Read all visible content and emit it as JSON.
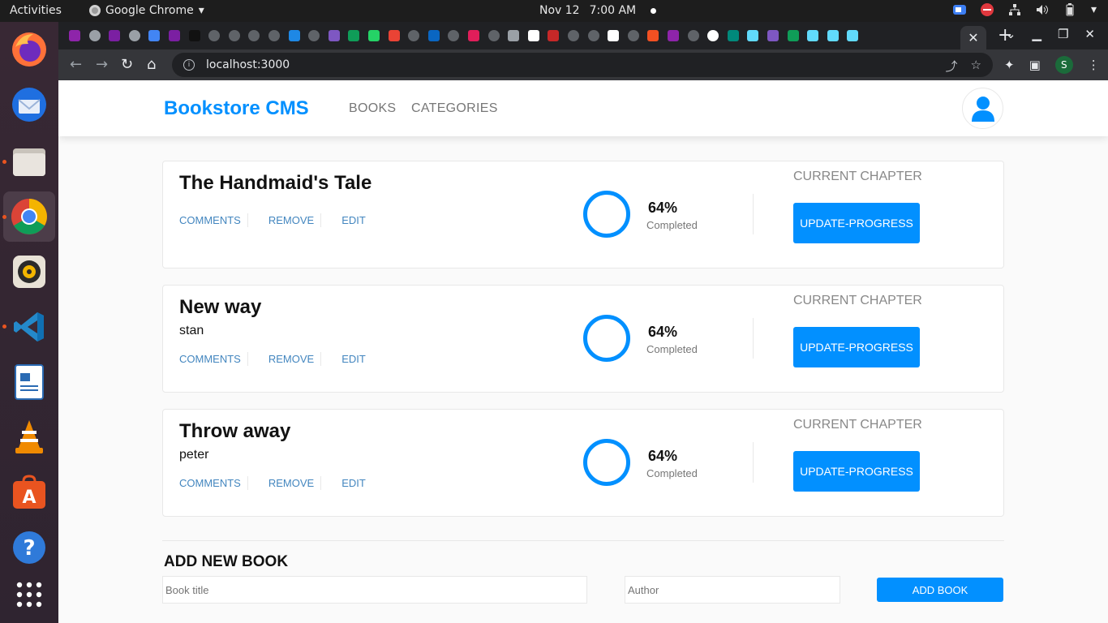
{
  "system": {
    "activities": "Activities",
    "app_name": "Google Chrome",
    "date": "Nov 12",
    "time": "7:00 AM"
  },
  "dock": {
    "apps": [
      "firefox-icon",
      "thunderbird-icon",
      "files-icon",
      "chrome-icon",
      "rhythmbox-icon",
      "vscode-icon",
      "writer-icon",
      "vlc-icon",
      "software-icon",
      "help-icon",
      "app-grid-icon"
    ]
  },
  "browser": {
    "url": "localhost:3000",
    "close_tab": "✕",
    "new_tab": "+",
    "profile_initial": "S"
  },
  "app": {
    "brand": "Bookstore CMS",
    "nav": {
      "books": "BOOKS",
      "categories": "CATEGORIES"
    }
  },
  "books": [
    {
      "title": "The Handmaid's Tale",
      "author": "",
      "percent": "64%",
      "completed_label": "Completed",
      "progress": 0.64,
      "chapter_label": "CURRENT CHAPTER",
      "button": "UPDATE-PROGRESS"
    },
    {
      "title": "New way",
      "author": "stan",
      "percent": "64%",
      "completed_label": "Completed",
      "progress": 0.64,
      "chapter_label": "CURRENT CHAPTER",
      "button": "UPDATE-PROGRESS"
    },
    {
      "title": "Throw away",
      "author": "peter",
      "percent": "64%",
      "completed_label": "Completed",
      "progress": 0.64,
      "chapter_label": "CURRENT CHAPTER",
      "button": "UPDATE-PROGRESS"
    }
  ],
  "actions": {
    "comments": "COMMENTS",
    "remove": "REMOVE",
    "edit": "EDIT"
  },
  "form": {
    "title": "ADD NEW BOOK",
    "title_placeholder": "Book title",
    "author_placeholder": "Author",
    "submit": "ADD BOOK"
  },
  "colors": {
    "accent": "#0290ff",
    "link": "#4386bf"
  }
}
